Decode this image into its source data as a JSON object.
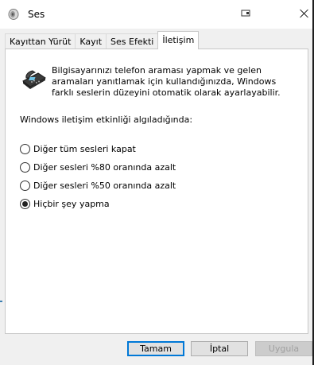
{
  "window": {
    "title": "Ses",
    "icon": "speaker-icon",
    "titlebar_icons": [
      "window-icon",
      "close-icon"
    ]
  },
  "tabs": [
    {
      "label": "Kayıttan Yürüt",
      "active": false
    },
    {
      "label": "Kayıt",
      "active": false
    },
    {
      "label": "Ses Efekti",
      "active": false
    },
    {
      "label": "İletişim",
      "active": true
    }
  ],
  "panel": {
    "icon": "telephone-icon",
    "description": "Bilgisayarınızı telefon araması yapmak ve gelen aramaları yanıtlamak için kullandığınızda, Windows farklı seslerin düzeyini otomatik olarak ayarlayabilir.",
    "section_label": "Windows iletişim etkinliği algıladığında:",
    "options": [
      {
        "label": "Diğer tüm sesleri kapat",
        "checked": false
      },
      {
        "label": "Diğer sesleri %80 oranında azalt",
        "checked": false
      },
      {
        "label": "Diğer sesleri %50 oranında azalt",
        "checked": false
      },
      {
        "label": "Hiçbir şey yapma",
        "checked": true
      }
    ]
  },
  "buttons": {
    "ok": "Tamam",
    "cancel": "İptal",
    "apply": "Uygula"
  },
  "colors": {
    "accent": "#0078d7",
    "dialog_bg": "#f0f0f0",
    "panel_bg": "#ffffff"
  }
}
